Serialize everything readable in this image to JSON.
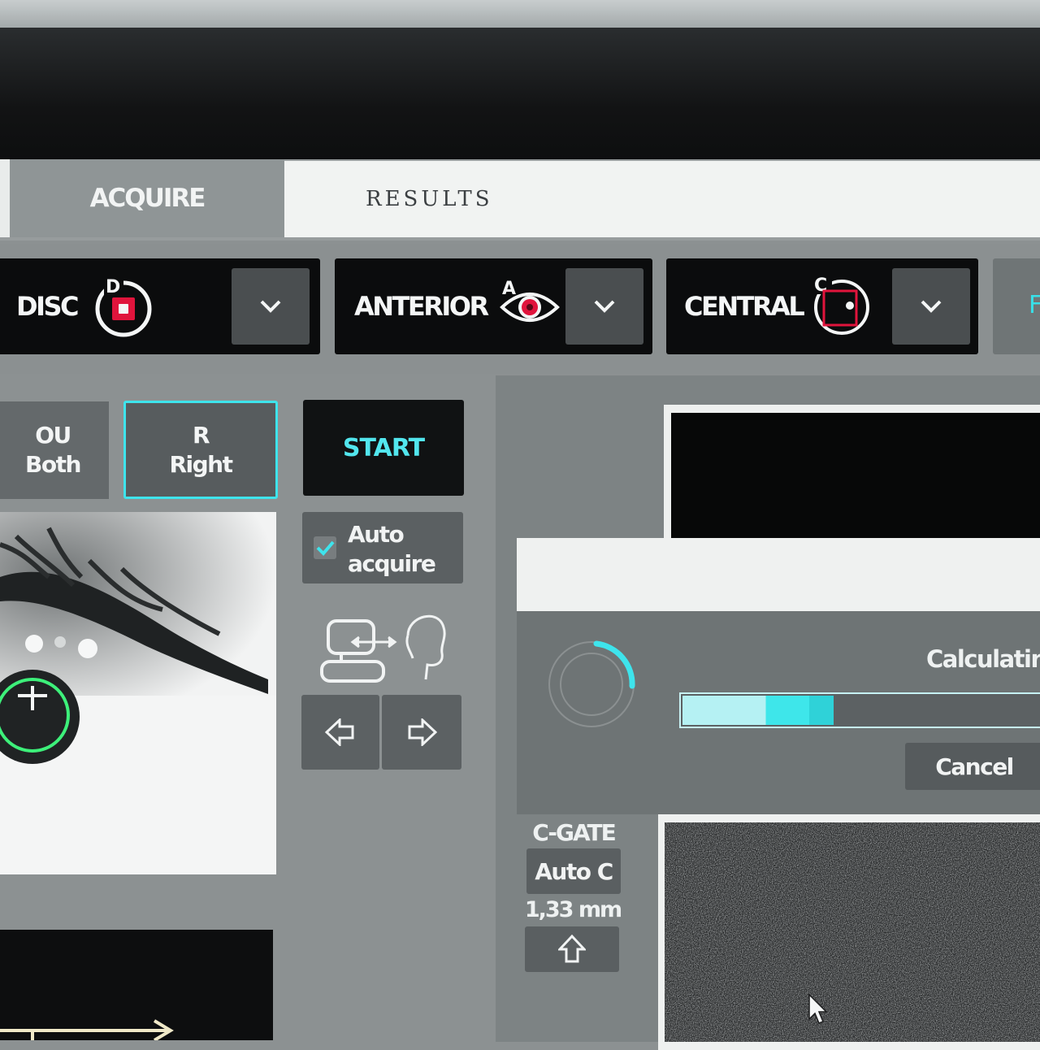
{
  "tabs": [
    {
      "label": "ACQUIRE",
      "active": true
    },
    {
      "label": "RESULTS",
      "active": false
    }
  ],
  "scan_modes": [
    {
      "label": "DISC",
      "icon": "disc-scan-icon",
      "badge": "D"
    },
    {
      "label": "ANTERIOR",
      "icon": "anterior-eye-icon",
      "badge": "A"
    },
    {
      "label": "CENTRAL",
      "icon": "central-scan-icon",
      "badge": "C"
    }
  ],
  "eye_select": {
    "ou": {
      "code": "OU",
      "label": "Both"
    },
    "r": {
      "code": "R",
      "label": "Right",
      "selected": true
    }
  },
  "acquire": {
    "start_label": "START",
    "auto_acquire_label_1": "Auto",
    "auto_acquire_label_2": "acquire",
    "auto_acquire_checked": true
  },
  "progress_dialog": {
    "status": "Calculating",
    "progress_percent": 42,
    "cancel_label": "Cancel"
  },
  "cgate": {
    "title": "C-GATE",
    "mode": "Auto C",
    "value": "1,33 mm"
  },
  "colors": {
    "accent": "#3ee4ec",
    "icon_red": "#e0143c",
    "target_green": "#3df07a"
  }
}
